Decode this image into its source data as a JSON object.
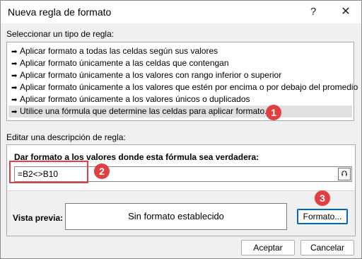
{
  "window": {
    "title": "Nueva regla de formato",
    "help_label": "?",
    "close_label": "✕"
  },
  "rule_type": {
    "label": "Seleccionar un tipo de regla:",
    "items": [
      "Aplicar formato a todas las celdas según sus valores",
      "Aplicar formato únicamente a las celdas que contengan",
      "Aplicar formato únicamente a los valores con rango inferior o superior",
      "Aplicar formato únicamente a los valores que estén por encima o por debajo del promedio",
      "Aplicar formato únicamente a los valores únicos o duplicados",
      "Utilice una fórmula que determine las celdas para aplicar formato."
    ],
    "selected_index": 5
  },
  "description": {
    "label": "Editar una descripción de regla:",
    "formula_label": "Dar formato a los valores donde esta fórmula sea verdadera:",
    "formula_value": "=B2<>B10",
    "preview_label": "Vista previa:",
    "preview_text": "Sin formato establecido",
    "format_button": "Formato..."
  },
  "buttons": {
    "accept": "Aceptar",
    "cancel": "Cancelar"
  },
  "callouts": [
    "1",
    "2",
    "3"
  ],
  "colors": {
    "callout": "#e04040",
    "selected_row": "#e0e0e0"
  }
}
